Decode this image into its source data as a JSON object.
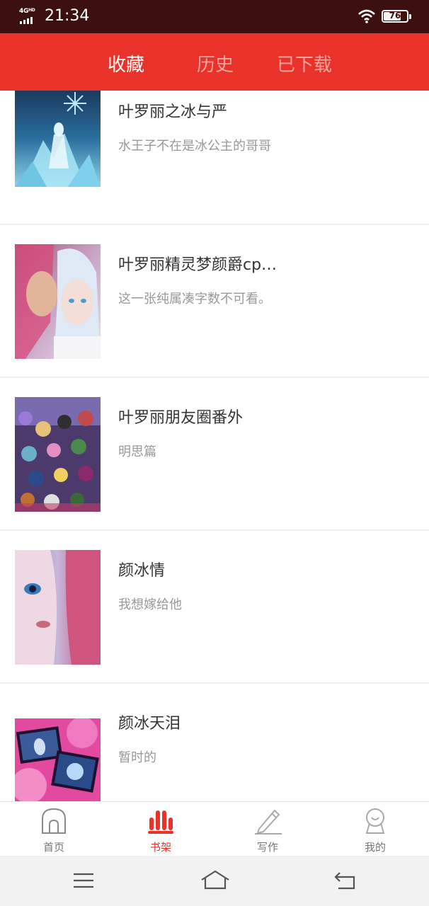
{
  "status_bar": {
    "network": "4G",
    "network_sub": "HD",
    "time": "21:34",
    "battery": "76",
    "battery_percent": 76
  },
  "top_tabs": [
    {
      "label": "收藏",
      "active": true
    },
    {
      "label": "历史",
      "active": false
    },
    {
      "label": "已下载",
      "active": false
    }
  ],
  "books": [
    {
      "title": "叶罗丽之冰与严",
      "desc": "水王子不在是冰公主的哥哥"
    },
    {
      "title": "叶罗丽精灵梦颜爵cp…",
      "desc": "这一张纯属凑字数不可看。"
    },
    {
      "title": "叶罗丽朋友圈番外",
      "desc": "明思篇"
    },
    {
      "title": "颜冰情",
      "desc": "我想嫁给他"
    },
    {
      "title": "颜冰天泪",
      "desc": "暂时的"
    }
  ],
  "bottom_nav": [
    {
      "label": "首页",
      "icon": "home-icon",
      "active": false
    },
    {
      "label": "书架",
      "icon": "bookshelf-icon",
      "active": true
    },
    {
      "label": "写作",
      "icon": "pen-icon",
      "active": false
    },
    {
      "label": "我的",
      "icon": "profile-icon",
      "active": false
    }
  ],
  "colors": {
    "accent": "#e9332a",
    "status_bar": "#3d1010"
  }
}
